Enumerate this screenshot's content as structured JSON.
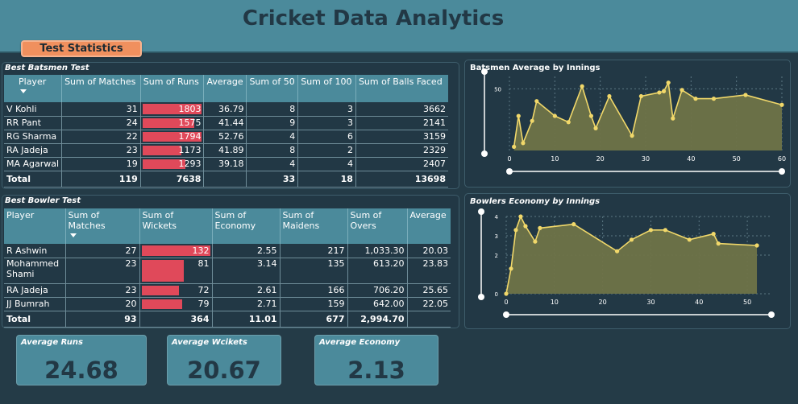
{
  "header": {
    "title": "Cricket Data Analytics"
  },
  "tab": {
    "label": "Test Statistics"
  },
  "batsmen": {
    "title": "Best Batsmen Test",
    "columns": [
      "Player",
      "Sum of Matches",
      "Sum of Runs",
      "Average",
      "Sum of 50",
      "Sum of 100",
      "Sum of Balls Faced"
    ],
    "max_runs": 1803,
    "rows": [
      {
        "player": "V Kohli",
        "matches": "31",
        "runs": "1803",
        "runs_value": 1803,
        "average": "36.79",
        "fifties": "8",
        "hundreds": "3",
        "balls": "3662"
      },
      {
        "player": "RR Pant",
        "matches": "24",
        "runs": "1575",
        "runs_value": 1575,
        "average": "41.44",
        "fifties": "9",
        "hundreds": "3",
        "balls": "2141"
      },
      {
        "player": "RG Sharma",
        "matches": "22",
        "runs": "1794",
        "runs_value": 1794,
        "average": "52.76",
        "fifties": "4",
        "hundreds": "6",
        "balls": "3159"
      },
      {
        "player": "RA Jadeja",
        "matches": "23",
        "runs": "1173",
        "runs_value": 1173,
        "average": "41.89",
        "fifties": "8",
        "hundreds": "2",
        "balls": "2329"
      },
      {
        "player": "MA Agarwal",
        "matches": "19",
        "runs": "1293",
        "runs_value": 1293,
        "average": "39.18",
        "fifties": "4",
        "hundreds": "4",
        "balls": "2407"
      }
    ],
    "total": {
      "label": "Total",
      "matches": "119",
      "runs": "7638",
      "average": "",
      "fifties": "33",
      "hundreds": "18",
      "balls": "13698"
    }
  },
  "bowlers": {
    "title": "Best Bowler Test",
    "columns": [
      "Player",
      "Sum of Matches",
      "Sum of Wickets",
      "Sum of Economy",
      "Sum of Maidens",
      "Sum of Overs",
      "Average"
    ],
    "max_wickets": 132,
    "rows": [
      {
        "player": "R Ashwin",
        "matches": "27",
        "wickets": "132",
        "wickets_value": 132,
        "economy": "2.55",
        "maidens": "217",
        "overs": "1,033.30",
        "average": "20.03"
      },
      {
        "player": "Mohammed Shami",
        "matches": "23",
        "wickets": "81",
        "wickets_value": 81,
        "economy": "3.14",
        "maidens": "135",
        "overs": "613.20",
        "average": "23.83"
      },
      {
        "player": "RA Jadeja",
        "matches": "23",
        "wickets": "72",
        "wickets_value": 72,
        "economy": "2.61",
        "maidens": "166",
        "overs": "706.20",
        "average": "25.65"
      },
      {
        "player": "JJ Bumrah",
        "matches": "20",
        "wickets": "79",
        "wickets_value": 79,
        "economy": "2.71",
        "maidens": "159",
        "overs": "642.00",
        "average": "22.05"
      }
    ],
    "total": {
      "label": "Total",
      "matches": "93",
      "wickets": "364",
      "economy": "11.01",
      "maidens": "677",
      "overs": "2,994.70",
      "average": ""
    }
  },
  "kpis": {
    "avg_runs": {
      "label": "Average Runs",
      "value": "24.68"
    },
    "avg_wickets": {
      "label": "Average Wcikets",
      "value": "20.67"
    },
    "avg_economy": {
      "label": "Average Economy",
      "value": "2.13"
    }
  },
  "chart_data": [
    {
      "type": "area",
      "title": "Batsmen Average by Innings",
      "xlabel": "",
      "ylabel": "",
      "xlim": [
        0,
        60
      ],
      "ylim": [
        0,
        60
      ],
      "xticks": [
        "0",
        "10",
        "20",
        "30",
        "40",
        "50",
        "60"
      ],
      "yticks": [
        "50"
      ],
      "x": [
        1,
        2,
        3,
        5,
        6,
        10,
        13,
        16,
        18,
        19,
        22,
        27,
        29,
        33,
        34,
        35,
        36,
        38,
        41,
        45,
        52,
        60
      ],
      "y": [
        3,
        28,
        6,
        24,
        40,
        28,
        23,
        52,
        28,
        18,
        44,
        12,
        44,
        47,
        48,
        55,
        26,
        49,
        42,
        42,
        45,
        37
      ],
      "grid": true,
      "color": "#f1d86a",
      "fill": "#6f7348"
    },
    {
      "type": "area",
      "title": "Bowlers Economy by Innings",
      "xlabel": "",
      "ylabel": "",
      "xlim": [
        0,
        55
      ],
      "ylim": [
        0,
        4
      ],
      "xticks": [
        "0",
        "10",
        "20",
        "30",
        "40",
        "50"
      ],
      "yticks": [
        "0",
        "2",
        "3",
        "4"
      ],
      "x": [
        0,
        1,
        2,
        3,
        4,
        6,
        7,
        14,
        23,
        26,
        30,
        33,
        38,
        43,
        44,
        52
      ],
      "y": [
        0,
        1.3,
        3.3,
        4.0,
        3.5,
        2.7,
        3.4,
        3.6,
        2.2,
        2.8,
        3.3,
        3.3,
        2.8,
        3.1,
        2.6,
        2.5
      ],
      "grid": true,
      "color": "#f1d86a",
      "fill": "#6f7348"
    }
  ]
}
